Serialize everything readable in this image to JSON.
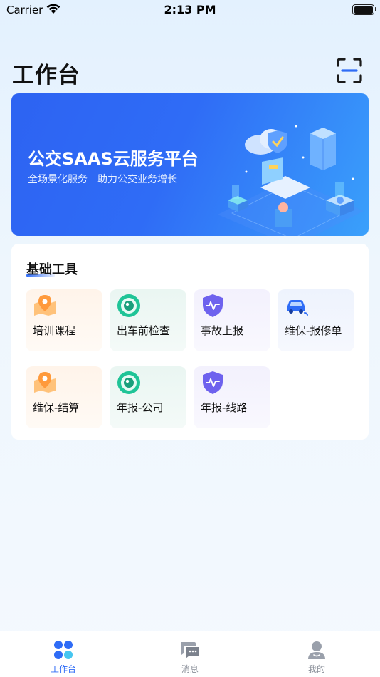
{
  "status_bar": {
    "carrier": "Carrier",
    "time": "2:13 PM"
  },
  "header": {
    "title": "工作台",
    "scan_icon": "scan-icon"
  },
  "banner": {
    "title": "公交SAAS云服务平台",
    "subtitle": "全场景化服务　助力公交业务增长"
  },
  "tools": {
    "title": "基础工具",
    "items": [
      {
        "label": "培训课程",
        "icon": "map-pin-icon",
        "theme": "orange"
      },
      {
        "label": "出车前检查",
        "icon": "camera-lens-icon",
        "theme": "green"
      },
      {
        "label": "事故上报",
        "icon": "shield-pulse-icon",
        "theme": "purple"
      },
      {
        "label": "维保-报修单",
        "icon": "car-repair-icon",
        "theme": "blue"
      },
      {
        "label": "维保-结算",
        "icon": "map-pin-icon",
        "theme": "orange"
      },
      {
        "label": "年报-公司",
        "icon": "camera-lens-icon",
        "theme": "green"
      },
      {
        "label": "年报-线路",
        "icon": "shield-pulse-icon",
        "theme": "purple"
      }
    ]
  },
  "tab_bar": {
    "items": [
      {
        "label": "工作台",
        "icon": "workbench-icon",
        "active": true
      },
      {
        "label": "消息",
        "icon": "message-icon",
        "active": false
      },
      {
        "label": "我的",
        "icon": "profile-icon",
        "active": false
      }
    ]
  },
  "colors": {
    "primary": "#2f6cf6",
    "tab_inactive": "#8a8f99"
  }
}
